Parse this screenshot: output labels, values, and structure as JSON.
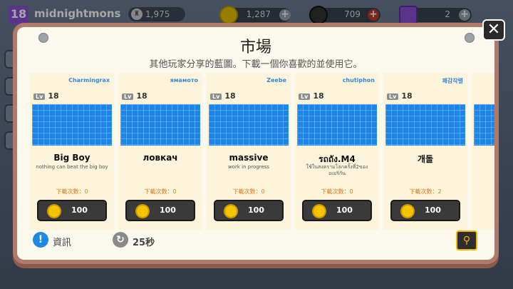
{
  "hud": {
    "level": "18",
    "player_name": "midnightmons",
    "trophies": "1,975",
    "coins": "1,287",
    "bombs": "709",
    "gems": "2"
  },
  "modal": {
    "title": "市場",
    "subtitle": "其他玩家分享的藍圖。下載一個你喜歡的並使用它。",
    "close": "✕"
  },
  "cards": [
    {
      "creator": "Charmingrax",
      "level_tag": "Lv",
      "level": "18",
      "name": "Big Boy",
      "description": "nothing can beat the  big boy",
      "downloads_label": "下載次數：",
      "downloads": "0",
      "price": "100"
    },
    {
      "creator": "ямамото",
      "level_tag": "Lv",
      "level": "18",
      "name": "ловкач",
      "description": "",
      "downloads_label": "下載次數：",
      "downloads": "0",
      "price": "100"
    },
    {
      "creator": "Zeebe",
      "level_tag": "Lv",
      "level": "18",
      "name": "massive",
      "description": "work in progress",
      "downloads_label": "下載次數：",
      "downloads": "0",
      "price": "100"
    },
    {
      "creator": "chutiphon",
      "level_tag": "Lv",
      "level": "18",
      "name": "รถถัง.M4",
      "description": "ใช้ในสงครามโลกครั้งที่2ของอเมริกัน",
      "downloads_label": "下載次數：",
      "downloads": "0",
      "price": "100"
    },
    {
      "creator": "쾌감작렬",
      "level_tag": "Lv",
      "level": "18",
      "name": "개돌",
      "description": "",
      "downloads_label": "下載次數：",
      "downloads": "2",
      "price": "100"
    }
  ],
  "footer": {
    "info_label": "資訊",
    "refresh_timer": "25秒"
  },
  "colors": {
    "accent_blue": "#1f86e8",
    "download_orange": "#e07a1a",
    "coin_gold": "#f7c400",
    "frame_brown": "#b07a6a"
  }
}
